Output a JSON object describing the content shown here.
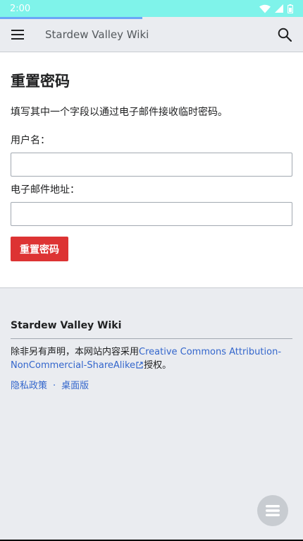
{
  "status_bar": {
    "time": "2:00"
  },
  "app_bar": {
    "title": "Stardew Valley Wiki"
  },
  "page": {
    "title": "重置密码",
    "instructions": "填写其中一个字段以通过电子邮件接收临时密码。",
    "username_label": "用户名：",
    "username_value": "",
    "email_label": "电子邮件地址：",
    "email_value": "",
    "submit_label": "重置密码"
  },
  "footer": {
    "site_name": "Stardew Valley Wiki",
    "license_prefix": "除非另有声明，本网站内容采用",
    "license_link": "Creative Commons Attribution-NonCommercial-ShareAlike",
    "license_suffix": "授权。",
    "privacy_link": "隐私政策",
    "separator": "·",
    "desktop_link": "桌面版"
  },
  "colors": {
    "status_bar": "#7ff3ea",
    "progress": "#6aa6f7",
    "link": "#3366cc",
    "primary_button": "#dd3333",
    "chrome_background": "#eaecf0"
  }
}
